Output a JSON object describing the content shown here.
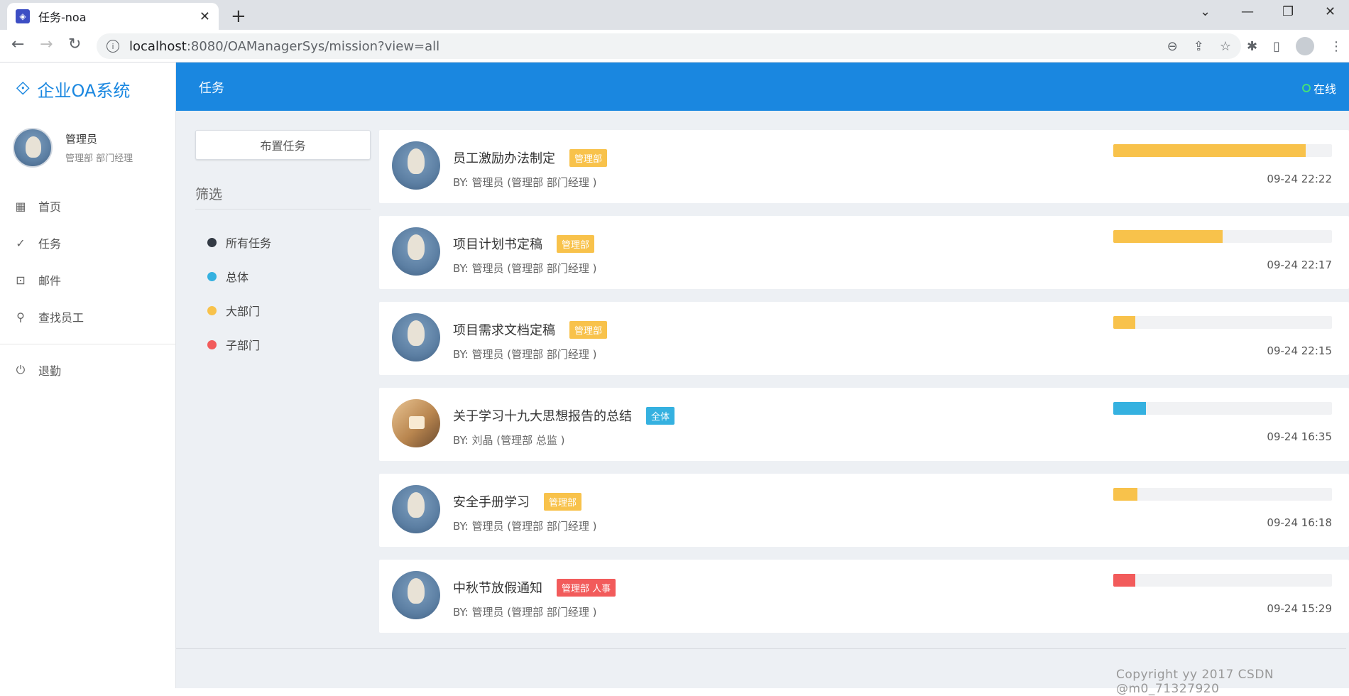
{
  "browser": {
    "tab_title": "任务-noa",
    "url_host": "localhost",
    "url_rest": ":8080/OAManagerSys/mission?view=all"
  },
  "app": {
    "brand": "企业OA系统",
    "header_title": "任务",
    "status": "在线",
    "status_color": "#43e07a",
    "accent": "#1a87e0"
  },
  "user": {
    "name": "管理员",
    "dept": "管理部 部门经理"
  },
  "menu": [
    {
      "label": "首页",
      "icon": "dashboard-icon"
    },
    {
      "label": "任务",
      "icon": "check-icon"
    },
    {
      "label": "邮件",
      "icon": "inbox-icon"
    },
    {
      "label": "查找员工",
      "icon": "search-icon"
    },
    {
      "label": "退勤",
      "icon": "power-icon"
    }
  ],
  "filters": {
    "assign_label": "布置任务",
    "title": "筛选",
    "items": [
      {
        "label": "所有任务",
        "color": "#333a44"
      },
      {
        "label": "总体",
        "color": "#35b1e0"
      },
      {
        "label": "大部门",
        "color": "#f8c24b"
      },
      {
        "label": "子部门",
        "color": "#f25b5b"
      }
    ]
  },
  "tasks": [
    {
      "title": "员工激励办法制定",
      "badge": "管理部",
      "badge_color": "#f8c24b",
      "by": "BY: 管理员 (管理部 部门经理 )",
      "progress": 0.88,
      "bar_color": "#f8c24b",
      "time": "09-24 22:22",
      "avatar": "portrait"
    },
    {
      "title": "项目计划书定稿",
      "badge": "管理部",
      "badge_color": "#f8c24b",
      "by": "BY: 管理员 (管理部 部门经理 )",
      "progress": 0.5,
      "bar_color": "#f8c24b",
      "time": "09-24 22:17",
      "avatar": "portrait"
    },
    {
      "title": "项目需求文档定稿",
      "badge": "管理部",
      "badge_color": "#f8c24b",
      "by": "BY: 管理员 (管理部 部门经理 )",
      "progress": 0.1,
      "bar_color": "#f8c24b",
      "time": "09-24 22:15",
      "avatar": "portrait"
    },
    {
      "title": "关于学习十九大思想报告的总结",
      "badge": "全体",
      "badge_color": "#35b1e0",
      "by": "BY: 刘晶 (管理部 总监 )",
      "progress": 0.15,
      "bar_color": "#35b1e0",
      "time": "09-24 16:35",
      "avatar": "photo"
    },
    {
      "title": "安全手册学习",
      "badge": "管理部",
      "badge_color": "#f8c24b",
      "by": "BY: 管理员 (管理部 部门经理 )",
      "progress": 0.11,
      "bar_color": "#f8c24b",
      "time": "09-24 16:18",
      "avatar": "portrait"
    },
    {
      "title": "中秋节放假通知",
      "badge": "管理部 人事",
      "badge_color": "#f25b5b",
      "by": "BY: 管理员 (管理部 部门经理 )",
      "progress": 0.1,
      "bar_color": "#f25b5b",
      "time": "09-24 15:29",
      "avatar": "portrait"
    }
  ],
  "footer": {
    "copyright": "Copyright yy 2017 CSDN @m0_71327920"
  }
}
